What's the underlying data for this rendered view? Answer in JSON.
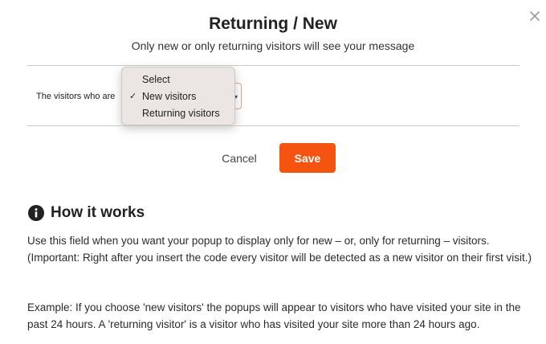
{
  "dialog": {
    "title": "Returning / New",
    "subtitle": "Only new or only returning visitors will see your message",
    "close_icon": "close-icon"
  },
  "field": {
    "label": "The visitors who are",
    "selected_value": "New visitors",
    "options": [
      {
        "label": "Select",
        "checked": false
      },
      {
        "label": "New visitors",
        "checked": true
      },
      {
        "label": "Returning visitors",
        "checked": false
      }
    ]
  },
  "actions": {
    "cancel_label": "Cancel",
    "save_label": "Save"
  },
  "help": {
    "icon": "info-icon",
    "title": "How it works",
    "paragraph1": "Use this field when you want your popup to display only for new – or, only for returning – visitors. (Important: Right after you insert the code every visitor will be detected as a new visitor on their first visit.)",
    "paragraph2": "Example: If you choose 'new visitors' the popups will appear to visitors who have visited your site in the past 24 hours. A 'returning visitor' is a visitor who has visited your site more than 24 hours ago."
  },
  "colors": {
    "accent": "#f4540f",
    "select_border": "#f3a07a",
    "dropdown_bg": "#ebe6e3",
    "divider": "#c9c9c9"
  }
}
